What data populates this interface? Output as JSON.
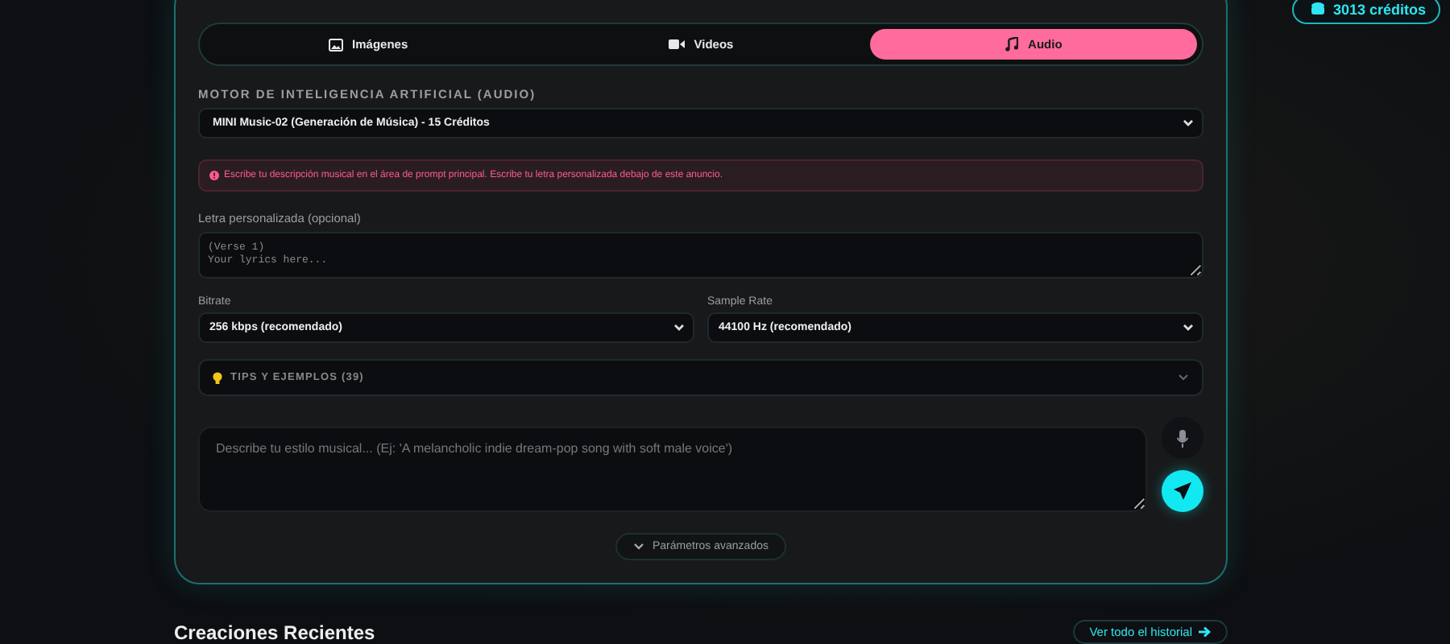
{
  "credits": {
    "label": "3013 créditos"
  },
  "tabs": [
    {
      "label": "Imágenes",
      "kind": "image",
      "selected": false
    },
    {
      "label": "Videos",
      "kind": "video",
      "selected": false
    },
    {
      "label": "Audio",
      "kind": "music",
      "selected": true
    }
  ],
  "engine": {
    "label": "MOTOR DE INTELIGENCIA ARTIFICIAL (AUDIO)",
    "value": "MINI Music-02 (Generación de Música) - 15 Créditos"
  },
  "alert": {
    "text": "Escribe tu descripción musical en el área de prompt principal. Escribe tu letra personalizada debajo de este anuncio."
  },
  "lyrics": {
    "label": "Letra personalizada (opcional)",
    "placeholder": "(Verse 1)\nYour lyrics here..."
  },
  "selects": [
    {
      "label": "Bitrate",
      "value": "256 kbps (recomendado)"
    },
    {
      "label": "Sample Rate",
      "value": "44100 Hz (recomendado)"
    }
  ],
  "tips": {
    "label": "TIPS Y EJEMPLOS (39)",
    "expanded": false
  },
  "prompt": {
    "placeholder": "Describe tu estilo musical... (Ej: 'A melancholic indie dream-pop song with soft male voice')"
  },
  "advanced": {
    "label": "Parámetros avanzados"
  },
  "recent": {
    "title": "Creaciones Recientes",
    "link": "Ver todo el historial"
  }
}
